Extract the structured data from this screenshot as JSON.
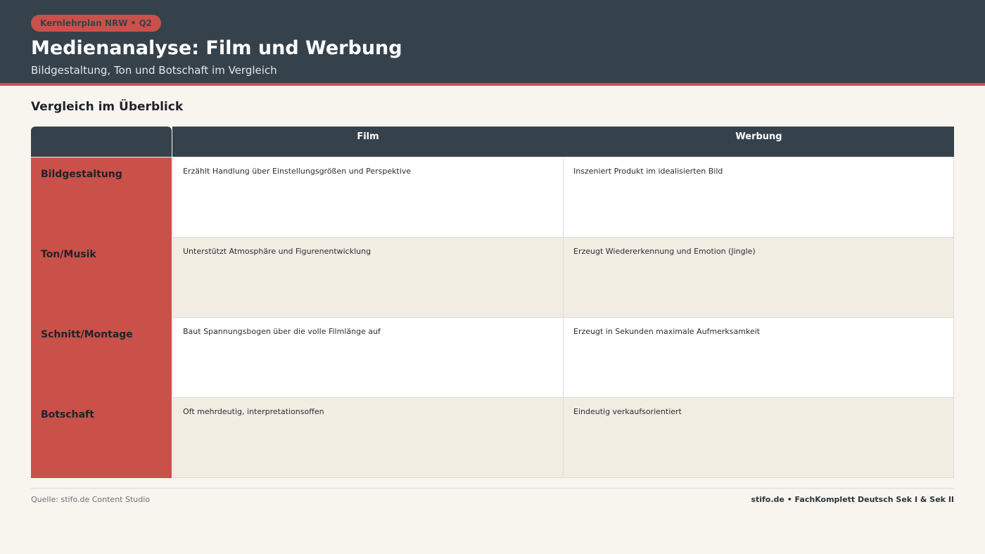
{
  "header": {
    "badge": "Kernlehrplan NRW • Q2",
    "title": "Medienanalyse: Film und Werbung",
    "subtitle": "Bildgestaltung, Ton und Botschaft im Vergleich"
  },
  "section_title": "Vergleich im Überblick",
  "table": {
    "columns": [
      "Film",
      "Werbung"
    ],
    "rows": [
      {
        "label": "Bildgestaltung",
        "film": "Erzählt Handlung über Einstellungsgrößen und Perspektive",
        "werbung": "Inszeniert Produkt im idealisierten Bild"
      },
      {
        "label": "Ton/Musik",
        "film": "Unterstützt Atmosphäre und Figurenentwicklung",
        "werbung": "Erzeugt Wiedererkennung und Emotion (Jingle)"
      },
      {
        "label": "Schnitt/Montage",
        "film": "Baut Spannungsbogen über die volle Filmlänge auf",
        "werbung": "Erzeugt in Sekunden maximale Aufmerksamkeit"
      },
      {
        "label": "Botschaft",
        "film": "Oft mehrdeutig, interpretationsoffen",
        "werbung": "Eindeutig verkaufsorientiert"
      }
    ]
  },
  "footer": {
    "source": "Quelle: stifo.de Content Studio",
    "brand": "stifo.de • FachKomplett Deutsch Sek I & Sek II"
  },
  "colors": {
    "header_bg": "#36424b",
    "accent_red": "#c9514a",
    "page_bg": "#f8f5ef",
    "row_alt_bg": "#f1ede3"
  }
}
